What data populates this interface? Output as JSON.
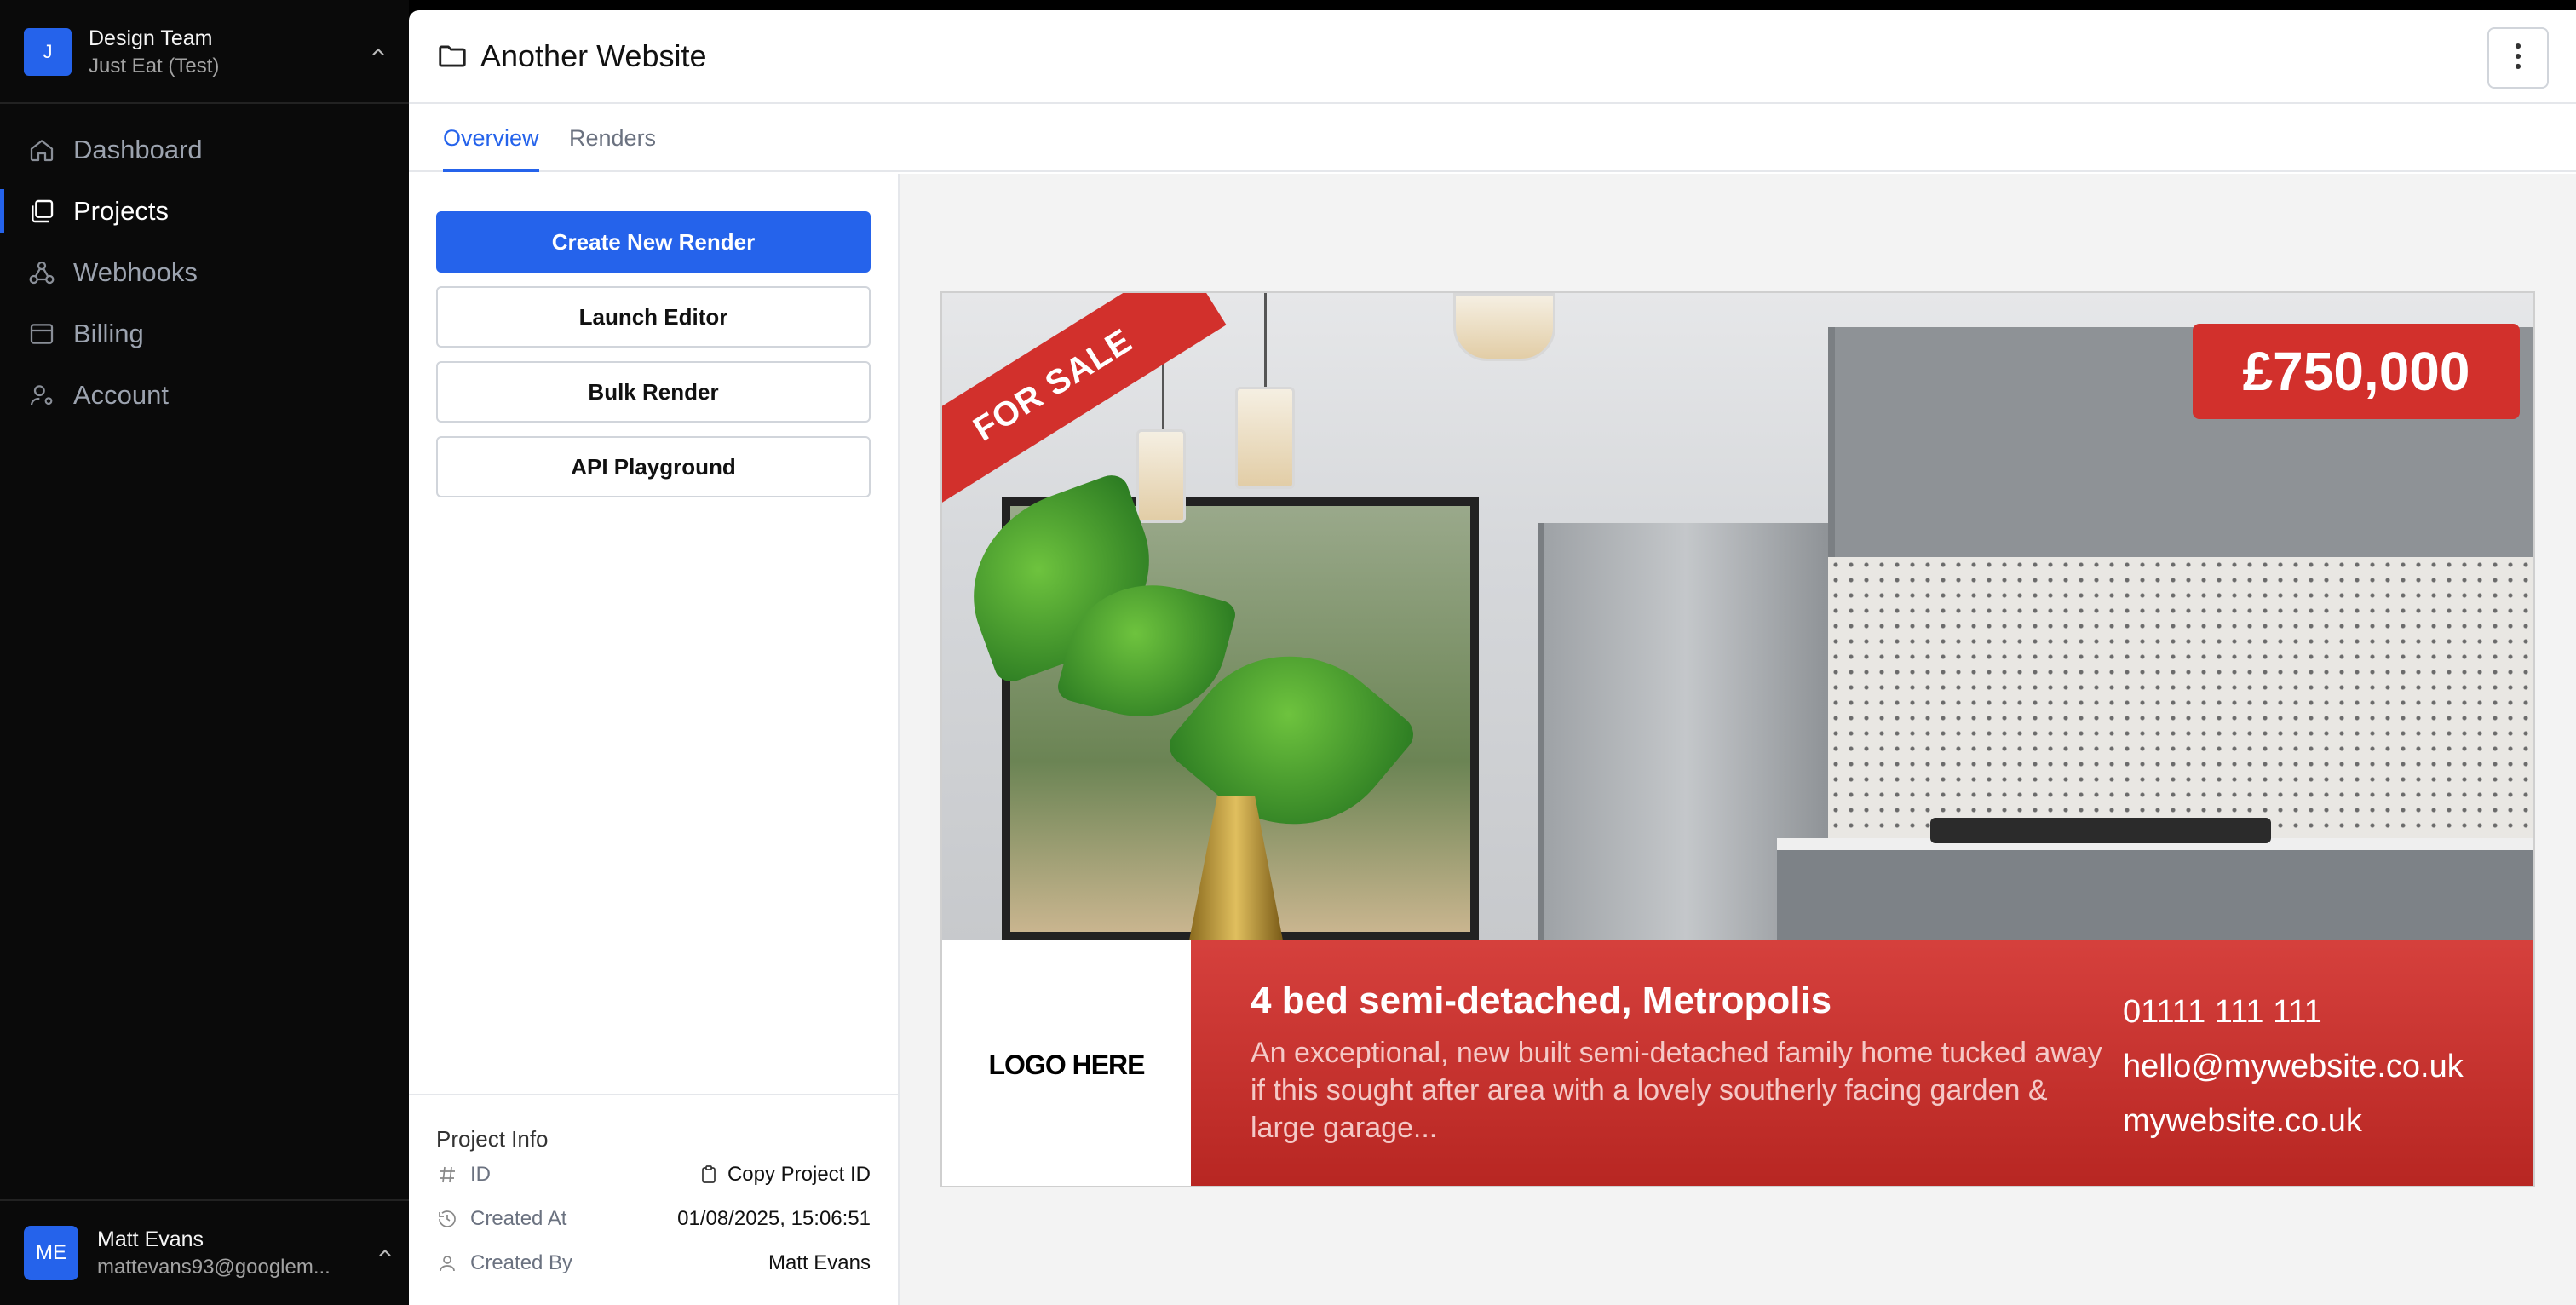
{
  "sidebar": {
    "team": {
      "initial": "J",
      "name": "Design Team",
      "subtitle": "Just Eat (Test)"
    },
    "nav": [
      {
        "label": "Dashboard",
        "icon": "home-icon",
        "active": false
      },
      {
        "label": "Projects",
        "icon": "projects-icon",
        "active": true
      },
      {
        "label": "Webhooks",
        "icon": "webhooks-icon",
        "active": false
      },
      {
        "label": "Billing",
        "icon": "billing-icon",
        "active": false
      },
      {
        "label": "Account",
        "icon": "account-icon",
        "active": false
      }
    ],
    "user": {
      "initials": "ME",
      "name": "Matt Evans",
      "email": "mattevans93@googlem..."
    }
  },
  "header": {
    "title": "Another Website"
  },
  "tabs": [
    {
      "label": "Overview",
      "active": true
    },
    {
      "label": "Renders",
      "active": false
    }
  ],
  "actions": {
    "create_new_render": "Create New Render",
    "launch_editor": "Launch Editor",
    "bulk_render": "Bulk Render",
    "api_playground": "API Playground"
  },
  "project_info": {
    "title": "Project Info",
    "id_label": "ID",
    "copy_id": "Copy Project ID",
    "created_at_label": "Created At",
    "created_at": "01/08/2025, 15:06:51",
    "created_by_label": "Created By",
    "created_by": "Matt Evans"
  },
  "preview": {
    "ribbon": "FOR SALE",
    "price": "£750,000",
    "logo": "LOGO HERE",
    "headline": "4 bed semi-detached, Metropolis",
    "description": "An exceptional, new built semi-detached family home tucked away if this sought after area with a lovely southerly facing garden & large garage...",
    "phone": "01111 111 111",
    "email": "hello@mywebsite.co.uk",
    "website": "mywebsite.co.uk"
  },
  "colors": {
    "accent": "#2563eb",
    "sidebar_bg": "#0a0a0a",
    "sale_red": "#d2302c"
  }
}
